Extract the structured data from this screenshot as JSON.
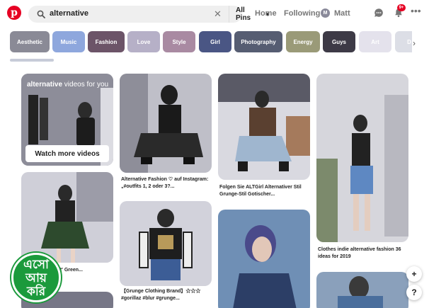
{
  "header": {
    "search_query": "alternative",
    "scope_label": "All Pins",
    "nav_home": "Home",
    "nav_following": "Following",
    "user_initial": "M",
    "user_name": "Matt",
    "notification_count": "9+"
  },
  "chips": [
    {
      "label": "Aesthetic",
      "color": "#8a8a96"
    },
    {
      "label": "Music",
      "color": "#8ea7dd"
    },
    {
      "label": "Fashion",
      "color": "#6c5468"
    },
    {
      "label": "Love",
      "color": "#b6b0c7"
    },
    {
      "label": "Style",
      "color": "#a98aa2"
    },
    {
      "label": "Girl",
      "color": "#4a5684"
    },
    {
      "label": "Photography",
      "color": "#565d72"
    },
    {
      "label": "Energy",
      "color": "#9a9a78"
    },
    {
      "label": "Guys",
      "color": "#3d3a46"
    },
    {
      "label": "Art",
      "color": "#e4e2ec"
    },
    {
      "label": "D",
      "color": "#dcdee6"
    }
  ],
  "promo": {
    "title_bold": "alternative",
    "title_rest": " videos for you",
    "button_label": "Watch more videos"
  },
  "pins": [
    {
      "caption": "Alternative Fashion ♡ auf Instagram: „#outfits 1, 2 oder 3?..."
    },
    {
      "caption": "Folgen Sie ALTGirl Alternativer Stil Grunge-Stil Gotischer..."
    },
    {
      "caption": "Clothes indie alternative fashion 36 ideas for 2019"
    },
    {
      "caption": "e Forest' Green..."
    },
    {
      "caption": "【Grunge Clothing Brand】☆☆☆ #gorillaz #blur #grunge..."
    }
  ],
  "floating": {
    "plus": "+",
    "help": "?"
  },
  "stamp": {
    "line1": "এসো",
    "line2": "আয়",
    "line3": "করি"
  }
}
